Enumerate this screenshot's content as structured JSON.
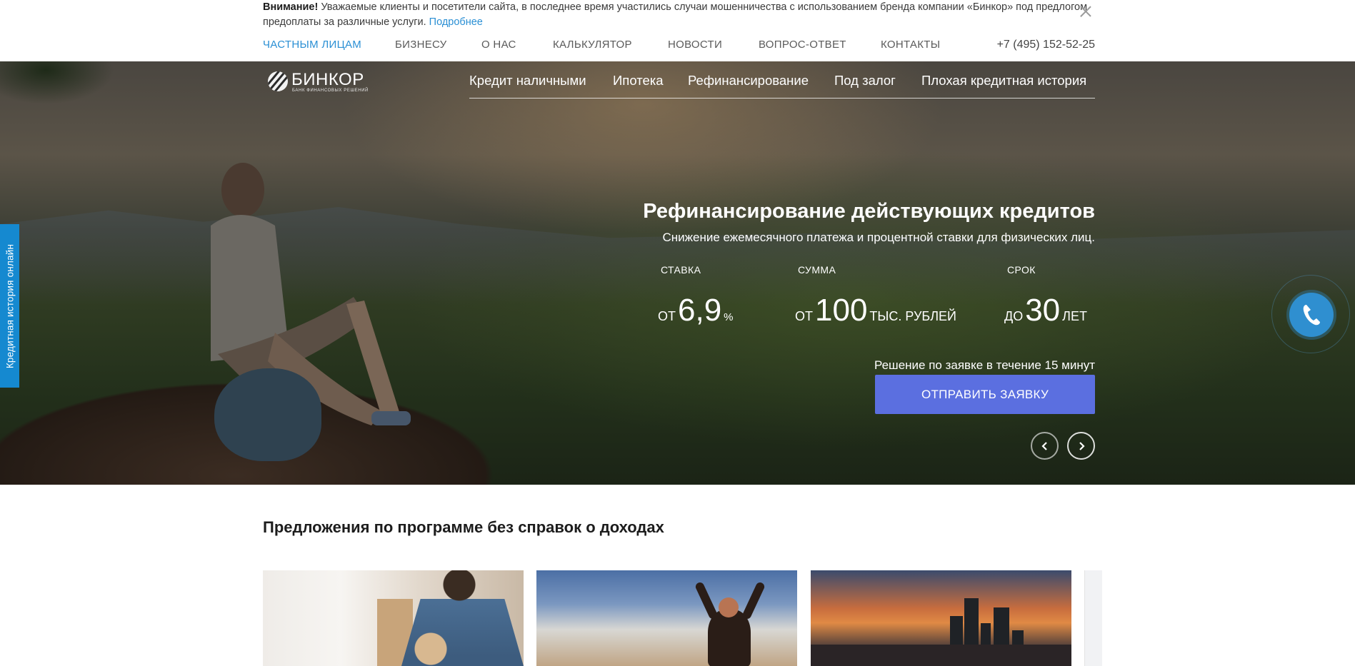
{
  "notice": {
    "bold": "Внимание!",
    "text": " Уважаемые клиенты и посетители сайта, в последнее время участились случаи мошенничества с использованием бренда компании «Бинкор» под предлогом предоплаты за различные услуги. ",
    "link": "Подробнее"
  },
  "topnav": {
    "items": [
      "ЧАСТНЫМ ЛИЦАМ",
      "БИЗНЕСУ",
      "О НАС",
      "КАЛЬКУЛЯТОР",
      "НОВОСТИ",
      "ВОПРОС-ОТВЕТ",
      "КОНТАКТЫ"
    ],
    "active_index": 0,
    "phone": "+7 (495) 152-52-25"
  },
  "logo": {
    "name": "БИНКОР",
    "tagline": "БАНК ФИНАНСОВЫХ РЕШЕНИЙ"
  },
  "mainnav": {
    "items": [
      "Кредит наличными",
      "Ипотека",
      "Рефинансирование",
      "Под залог",
      "Плохая кредитная история"
    ]
  },
  "slide": {
    "title": "Рефинансирование действующих кредитов",
    "subtitle": "Снижение ежемесячного платежа и процентной ставки для физических лиц.",
    "stats": [
      {
        "label": "СТАВКА",
        "prefix": "от",
        "value": "6,9",
        "suffix": "%"
      },
      {
        "label": "СУММА",
        "prefix": "от",
        "value": "100",
        "suffix": "тыс. рублей"
      },
      {
        "label": "СРОК",
        "prefix": "до",
        "value": "30",
        "suffix": "лет"
      }
    ],
    "decision": "Решение по заявке в течение 15 минут",
    "cta": "ОТПРАВИТЬ ЗАЯВКУ"
  },
  "side_tab": "Кредитная история онлайн",
  "offers": {
    "title": "Предложения по программе без справок о доходах"
  },
  "colors": {
    "accent": "#2a8fd4",
    "cta": "#5b6fe0",
    "side_tab": "#1589d0"
  }
}
